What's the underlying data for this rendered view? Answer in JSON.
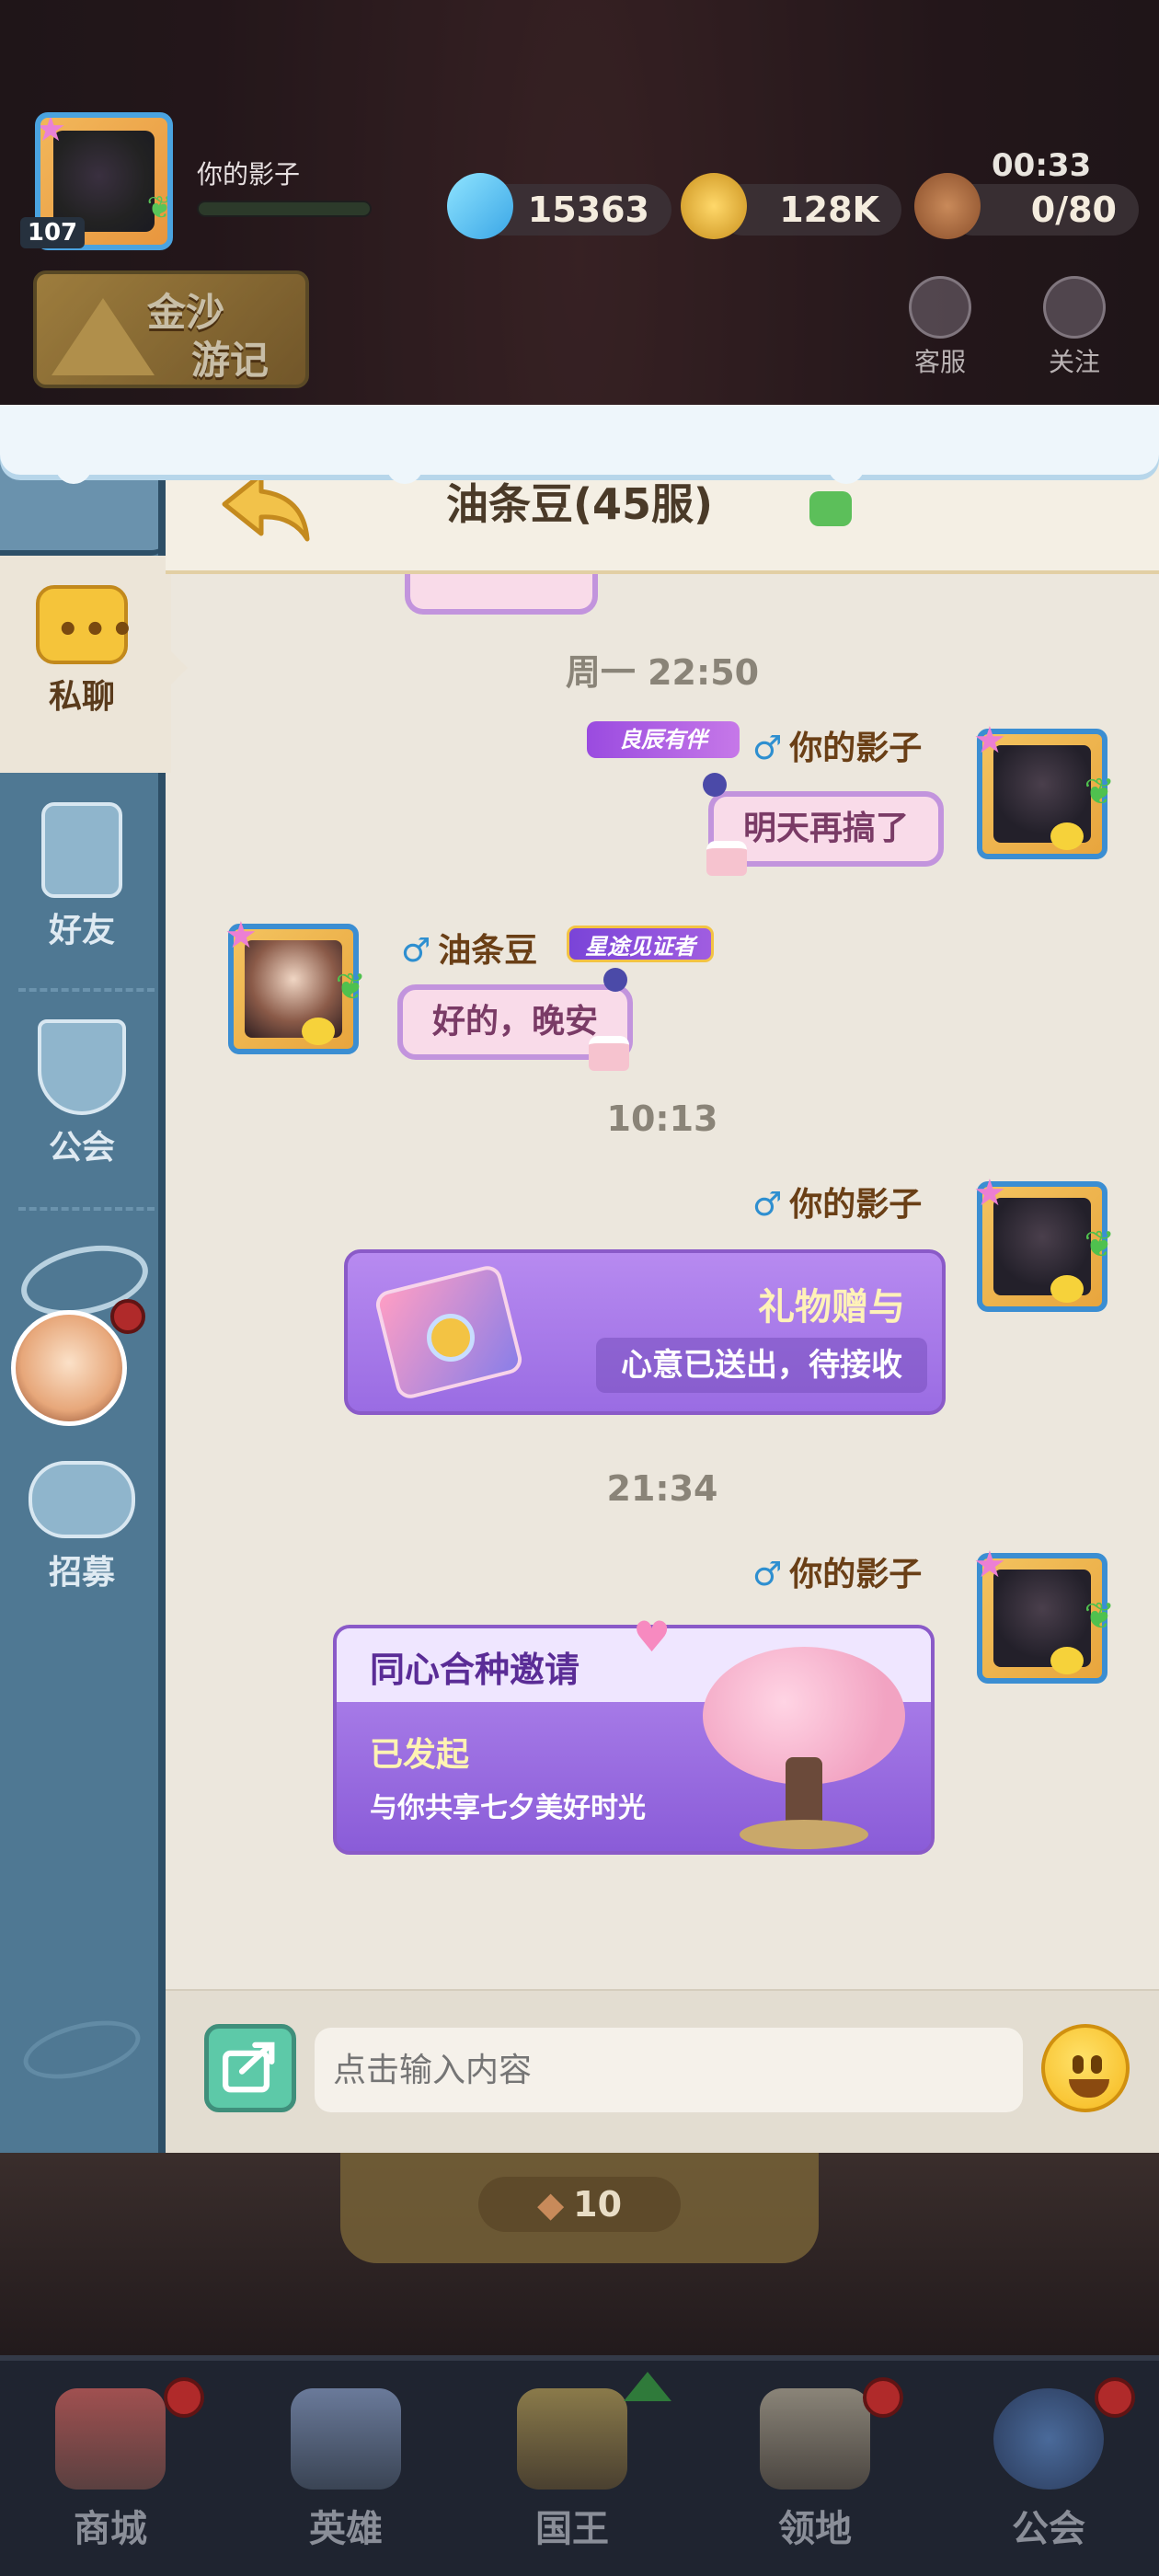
{
  "top_bar": {
    "player_name": "你的影子",
    "level": "107",
    "xp_fraction": 0.0,
    "gems": "15363",
    "gold": "128K",
    "stamina": "0/80",
    "timer": "00:33",
    "event_banner": [
      "金沙",
      "游记"
    ],
    "service_label": "客服",
    "follow_label": "关注"
  },
  "sidebar": {
    "tabs": [
      {
        "label": "私聊",
        "icon": "chat-bubble-icon",
        "active": true
      },
      {
        "label": "好友",
        "icon": "contacts-book-icon"
      },
      {
        "label": "公会",
        "icon": "guild-shield-icon"
      },
      {
        "label": "招募",
        "icon": "handshake-icon"
      }
    ]
  },
  "chat": {
    "title": "油条豆(45服)",
    "messages": [
      {
        "timestamp": "周一 22:50"
      },
      {
        "sender": "你的影子",
        "gender": "♂",
        "tag": "良辰有伴",
        "text": "明天再搞了",
        "side": "right"
      },
      {
        "sender": "油条豆",
        "gender": "♂",
        "tag": "星途见证者",
        "text": "好的，晚安",
        "side": "left"
      },
      {
        "timestamp": "10:13"
      },
      {
        "sender": "你的影子",
        "gender": "♂",
        "side": "right",
        "card": "gift",
        "card_title": "礼物赠与",
        "card_sub": "心意已送出，待接收"
      },
      {
        "timestamp": "21:34"
      },
      {
        "sender": "你的影子",
        "gender": "♂",
        "side": "right",
        "card": "invite",
        "card_title": "同心合种邀请",
        "card_status": "已发起",
        "card_sub": "与你共享七夕美好时光"
      }
    ],
    "input_placeholder": "点击输入内容"
  },
  "below": {
    "cost": "10"
  },
  "bottom_nav": [
    {
      "label": "商城",
      "badge": true
    },
    {
      "label": "英雄",
      "badge": false
    },
    {
      "label": "国王",
      "badge": false,
      "arrow": true
    },
    {
      "label": "领地",
      "badge": true
    },
    {
      "label": "公会",
      "badge": true
    }
  ],
  "colors": {
    "sidebar": "#4f7893",
    "panel_bg": "#ece7dd",
    "bubble": "#f9dbe9",
    "card_purple": "#9a6ce3",
    "name_brown": "#6a3f16"
  }
}
